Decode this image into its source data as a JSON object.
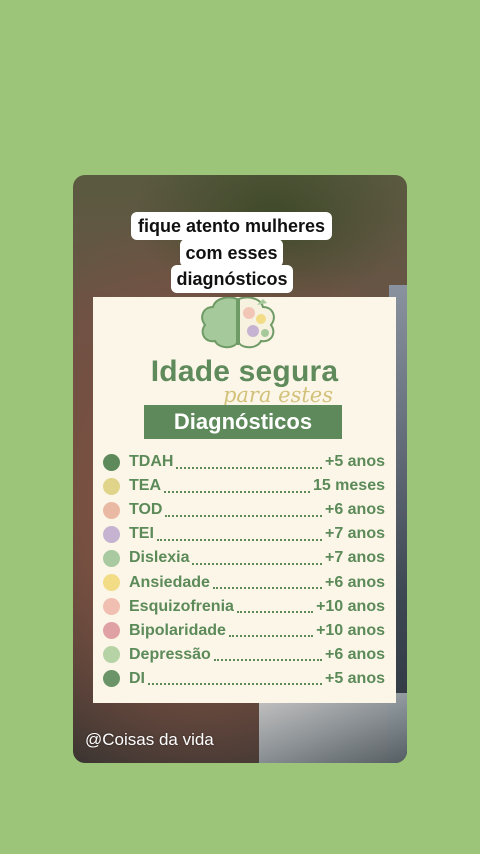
{
  "caption": {
    "lines": [
      "fique atento mulheres",
      "com esses",
      "diagnósticos"
    ]
  },
  "poster": {
    "title": "Idade segura",
    "subtitle": "para estes",
    "heading": "Diagnósticos",
    "items": [
      {
        "name": "TDAH",
        "age": "+5 anos",
        "color": "#5e8a5b"
      },
      {
        "name": "TEA",
        "age": "15 meses",
        "color": "#e0d48a"
      },
      {
        "name": "TOD",
        "age": "+6 anos",
        "color": "#eab9a3"
      },
      {
        "name": "TEI",
        "age": "+7 anos",
        "color": "#c6b3d2"
      },
      {
        "name": "Dislexia",
        "age": "+7 anos",
        "color": "#a9c9a0"
      },
      {
        "name": "Ansiedade",
        "age": "+6 anos",
        "color": "#f2dc86"
      },
      {
        "name": "Esquizofrenia",
        "age": "+10 anos",
        "color": "#f0bfb2"
      },
      {
        "name": "Bipolaridade",
        "age": "+10 anos",
        "color": "#e0a1a4"
      },
      {
        "name": "Depressão",
        "age": "+6 anos",
        "color": "#b6d3a6"
      },
      {
        "name": "DI",
        "age": "+5 anos",
        "color": "#6b9568"
      }
    ]
  },
  "watermark": "@Coisas da vida",
  "colors": {
    "background": "#9dc57a",
    "accent_green": "#5e8a5b",
    "poster_bg": "#fbf6e7",
    "subtitle_gold": "#c9b460"
  },
  "icons": {
    "poster_logo": "brain-puzzle-icon"
  }
}
